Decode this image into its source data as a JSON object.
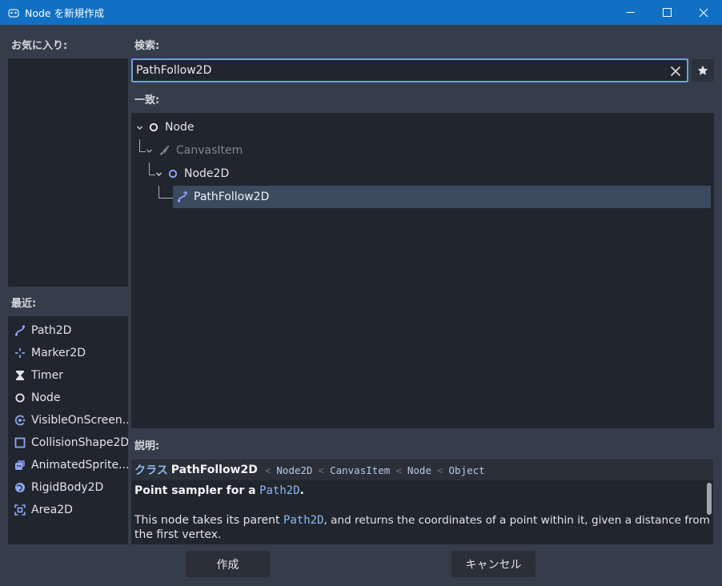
{
  "window": {
    "title": "Node を新規作成"
  },
  "favorites": {
    "label": "お気に入り:"
  },
  "recent": {
    "label": "最近:",
    "items": [
      {
        "label": "Path2D",
        "icon": "path-icon"
      },
      {
        "label": "Marker2D",
        "icon": "marker-icon"
      },
      {
        "label": "Timer",
        "icon": "timer-icon"
      },
      {
        "label": "Node",
        "icon": "node-circle-icon"
      },
      {
        "label": "VisibleOnScreen...",
        "icon": "visible-notifier-icon"
      },
      {
        "label": "CollisionShape2D",
        "icon": "collision-shape-icon"
      },
      {
        "label": "AnimatedSprite...",
        "icon": "animated-sprite-icon"
      },
      {
        "label": "RigidBody2D",
        "icon": "rigid-body-icon"
      },
      {
        "label": "Area2D",
        "icon": "area-icon"
      }
    ]
  },
  "search": {
    "label": "検索:",
    "value": "PathFollow2D"
  },
  "matches": {
    "label": "一致:",
    "tree": [
      {
        "label": "Node"
      },
      {
        "label": "CanvasItem"
      },
      {
        "label": "Node2D"
      },
      {
        "label": "PathFollow2D"
      }
    ]
  },
  "description": {
    "label": "説明:",
    "class_prefix": "クラス",
    "class_name": "PathFollow2D",
    "inheritance": [
      "Node2D",
      "CanvasItem",
      "Node",
      "Object"
    ],
    "sep": "<",
    "line1_bold": "Point sampler for a",
    "line1_code": "Path2D",
    "line1_end": ".",
    "line2_pre": "This node takes its parent",
    "line2_code": "Path2D",
    "line2_post": ", and returns the coordinates of a point within it, given a distance from",
    "line3": "the first vertex."
  },
  "buttons": {
    "create": "作成",
    "cancel": "キャンセル"
  },
  "colors": {
    "accent": "#1170c4",
    "selected": "#3b4a5e",
    "link": "#8eb8f0",
    "icon_blue": "#8da5f3"
  }
}
